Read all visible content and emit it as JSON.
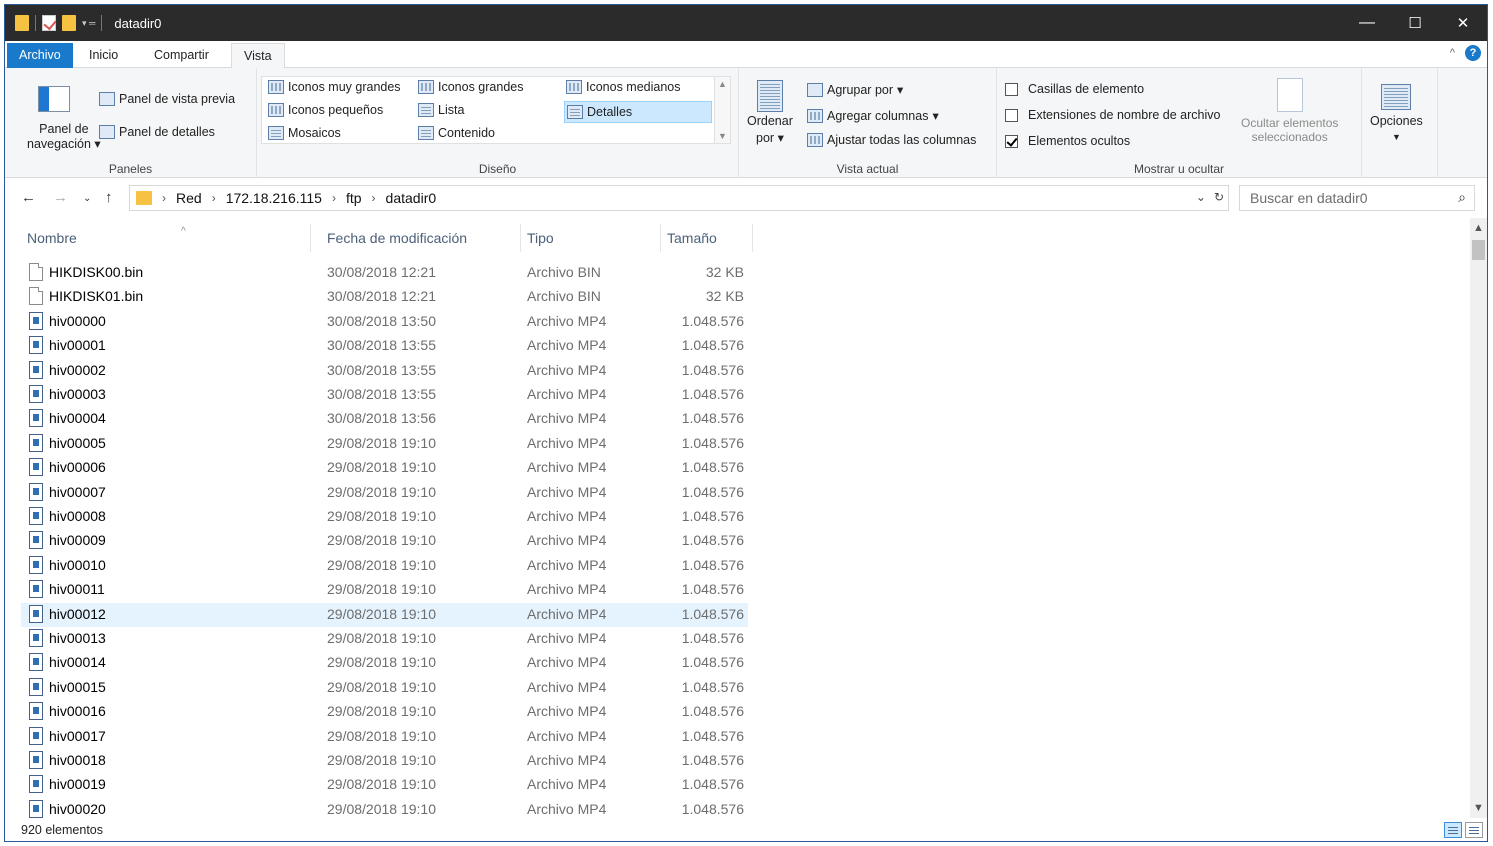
{
  "window": {
    "title": "datadir0",
    "controls": {
      "minimize": "—",
      "maximize": "☐",
      "close": "✕"
    }
  },
  "ribbon_tabs": [
    "Archivo",
    "Inicio",
    "Compartir",
    "Vista"
  ],
  "ribbon": {
    "panes": {
      "label": "Paneles",
      "nav_pane_line1": "Panel de",
      "nav_pane_line2": "navegación",
      "preview_pane": "Panel de vista previa",
      "details_pane": "Panel de detalles"
    },
    "layout": {
      "label": "Diseño",
      "options": [
        "Iconos muy grandes",
        "Iconos grandes",
        "Iconos medianos",
        "Iconos pequeños",
        "Lista",
        "Detalles",
        "Mosaicos",
        "Contenido"
      ],
      "selected": "Detalles"
    },
    "current_view": {
      "label": "Vista actual",
      "sort_line1": "Ordenar",
      "sort_line2": "por",
      "group_by": "Agrupar por",
      "add_columns": "Agregar columnas",
      "fit_columns": "Ajustar todas las columnas"
    },
    "show_hide": {
      "label": "Mostrar u ocultar",
      "item_checkboxes": "Casillas de elemento",
      "item_checkboxes_checked": false,
      "file_extensions": "Extensiones de nombre de archivo",
      "file_extensions_checked": false,
      "hidden_items": "Elementos ocultos",
      "hidden_items_checked": true,
      "hide_selected_line1": "Ocultar elementos",
      "hide_selected_line2": "seleccionados"
    },
    "options": "Opciones"
  },
  "address": {
    "breadcrumbs": [
      "Red",
      "172.18.216.115",
      "ftp",
      "datadir0"
    ],
    "search_placeholder": "Buscar en datadir0"
  },
  "columns": [
    "Nombre",
    "Fecha de modificación",
    "Tipo",
    "Tamaño"
  ],
  "files": [
    {
      "name": "HIKDISK00.bin",
      "date": "30/08/2018 12:21",
      "type": "Archivo BIN",
      "size": "32 KB",
      "icon": "bin"
    },
    {
      "name": "HIKDISK01.bin",
      "date": "30/08/2018 12:21",
      "type": "Archivo BIN",
      "size": "32 KB",
      "icon": "bin"
    },
    {
      "name": "hiv00000",
      "date": "30/08/2018 13:50",
      "type": "Archivo MP4",
      "size": "1.048.576",
      "icon": "mp4"
    },
    {
      "name": "hiv00001",
      "date": "30/08/2018 13:55",
      "type": "Archivo MP4",
      "size": "1.048.576",
      "icon": "mp4"
    },
    {
      "name": "hiv00002",
      "date": "30/08/2018 13:55",
      "type": "Archivo MP4",
      "size": "1.048.576",
      "icon": "mp4"
    },
    {
      "name": "hiv00003",
      "date": "30/08/2018 13:55",
      "type": "Archivo MP4",
      "size": "1.048.576",
      "icon": "mp4"
    },
    {
      "name": "hiv00004",
      "date": "30/08/2018 13:56",
      "type": "Archivo MP4",
      "size": "1.048.576",
      "icon": "mp4"
    },
    {
      "name": "hiv00005",
      "date": "29/08/2018 19:10",
      "type": "Archivo MP4",
      "size": "1.048.576",
      "icon": "mp4"
    },
    {
      "name": "hiv00006",
      "date": "29/08/2018 19:10",
      "type": "Archivo MP4",
      "size": "1.048.576",
      "icon": "mp4"
    },
    {
      "name": "hiv00007",
      "date": "29/08/2018 19:10",
      "type": "Archivo MP4",
      "size": "1.048.576",
      "icon": "mp4"
    },
    {
      "name": "hiv00008",
      "date": "29/08/2018 19:10",
      "type": "Archivo MP4",
      "size": "1.048.576",
      "icon": "mp4"
    },
    {
      "name": "hiv00009",
      "date": "29/08/2018 19:10",
      "type": "Archivo MP4",
      "size": "1.048.576",
      "icon": "mp4"
    },
    {
      "name": "hiv00010",
      "date": "29/08/2018 19:10",
      "type": "Archivo MP4",
      "size": "1.048.576",
      "icon": "mp4"
    },
    {
      "name": "hiv00011",
      "date": "29/08/2018 19:10",
      "type": "Archivo MP4",
      "size": "1.048.576",
      "icon": "mp4"
    },
    {
      "name": "hiv00012",
      "date": "29/08/2018 19:10",
      "type": "Archivo MP4",
      "size": "1.048.576",
      "icon": "mp4",
      "selected": true
    },
    {
      "name": "hiv00013",
      "date": "29/08/2018 19:10",
      "type": "Archivo MP4",
      "size": "1.048.576",
      "icon": "mp4"
    },
    {
      "name": "hiv00014",
      "date": "29/08/2018 19:10",
      "type": "Archivo MP4",
      "size": "1.048.576",
      "icon": "mp4"
    },
    {
      "name": "hiv00015",
      "date": "29/08/2018 19:10",
      "type": "Archivo MP4",
      "size": "1.048.576",
      "icon": "mp4"
    },
    {
      "name": "hiv00016",
      "date": "29/08/2018 19:10",
      "type": "Archivo MP4",
      "size": "1.048.576",
      "icon": "mp4"
    },
    {
      "name": "hiv00017",
      "date": "29/08/2018 19:10",
      "type": "Archivo MP4",
      "size": "1.048.576",
      "icon": "mp4"
    },
    {
      "name": "hiv00018",
      "date": "29/08/2018 19:10",
      "type": "Archivo MP4",
      "size": "1.048.576",
      "icon": "mp4"
    },
    {
      "name": "hiv00019",
      "date": "29/08/2018 19:10",
      "type": "Archivo MP4",
      "size": "1.048.576",
      "icon": "mp4"
    },
    {
      "name": "hiv00020",
      "date": "29/08/2018 19:10",
      "type": "Archivo MP4",
      "size": "1.048.576",
      "icon": "mp4"
    }
  ],
  "status": {
    "count": "920 elementos"
  },
  "colors": {
    "accent": "#1979ca",
    "titlebar": "#2b2b2b",
    "selection": "#e5f3ff",
    "header_text": "#4c607a"
  }
}
